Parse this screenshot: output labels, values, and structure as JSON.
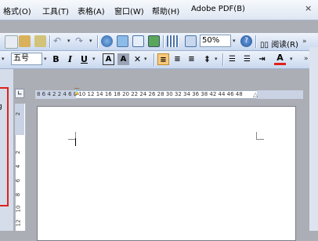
{
  "menu": {
    "items": [
      "格式(O)",
      "工具(T)",
      "表格(A)",
      "窗口(W)",
      "帮助(H)",
      "Adobe PDF(B)"
    ],
    "close": "×"
  },
  "toolbar1": {
    "zoom_value": "50%",
    "read_label": "阅读(R)"
  },
  "toolbar2": {
    "font_size": "五号",
    "bold": "B",
    "italic": "I",
    "underline": "U",
    "char_border": "A",
    "font_color": "A"
  },
  "ruler": {
    "h_numbers": "8 6 4 2   2 4 6 8 10 12 14 16 18 20 22 24 26 28 30 32 34 36 38   42 44 46 48",
    "v_numbers": [
      "2",
      "2",
      "4",
      "6",
      "8",
      "10",
      "12"
    ]
  },
  "left_panel": {
    "glyph": "g"
  }
}
